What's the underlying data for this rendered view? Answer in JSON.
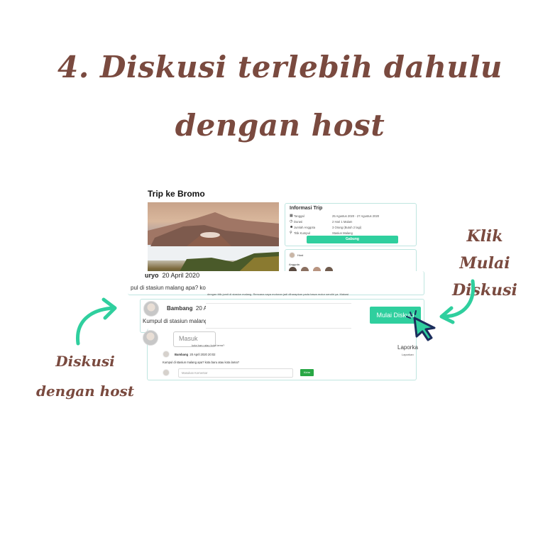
{
  "heading": {
    "line1": "4. Diskusi terlebih dahulu",
    "line2": "dengan host"
  },
  "annotations": {
    "right": [
      "Klik",
      "Mulai Diskusi"
    ],
    "left": [
      "Diskusi",
      "dengan host"
    ]
  },
  "trip": {
    "title": "Trip ke Bromo",
    "info": {
      "title": "Informasi Trip",
      "rows": [
        {
          "icon": "calendar-icon",
          "label": "Tanggal",
          "value": "25 Agustus 2020 - 27 Agustus 2020"
        },
        {
          "icon": "clock-icon",
          "label": "Durasi",
          "value": "2 Hari 1 Malam"
        },
        {
          "icon": "users-icon",
          "label": "Jumlah Anggota",
          "value": "3 Orang (Butuh 2 lagi)"
        },
        {
          "icon": "pin-icon",
          "label": "Titik Kumpul",
          "value": "Stasiun Malang"
        }
      ],
      "join_button": "Gabung"
    },
    "members": {
      "host_label": "Host",
      "anggota_label": "Anggota"
    }
  },
  "discussion": {
    "comment1": {
      "name_fragment": "uryo",
      "date": "20 April 2020",
      "text": "pul di stasiun malang apa? ko",
      "overlay_text": "dengan titik jumit di stasiun malang. Rencana saya motoran jadi diharapkan pada bawa motor sendiri ya. Makasi"
    },
    "comment2": {
      "name": "Bambang",
      "date_fragment": "20 Ap",
      "text": "Kumpul di stasiun malang a",
      "overlay_text": "ik Rencan",
      "start_button": "Mulai Diskusi"
    },
    "compose": {
      "placeholder": "Masuk",
      "tiny_text": "kota baru atau kota lama?",
      "report_label": "Laporka",
      "report_small": "Laporkan"
    },
    "reply": {
      "name": "Bambang",
      "date": "20 April 2020 20:02",
      "text": "Kumpul di stasiun malang apa? kota baru atau kota lama?",
      "input_placeholder": "Masukan Komentar",
      "send_button": "Kirim"
    }
  },
  "colors": {
    "accent": "#2fcf9e",
    "heading": "#7a4a3f",
    "arrow": "#2fcf9e",
    "cursor": "#1b2d5c"
  }
}
